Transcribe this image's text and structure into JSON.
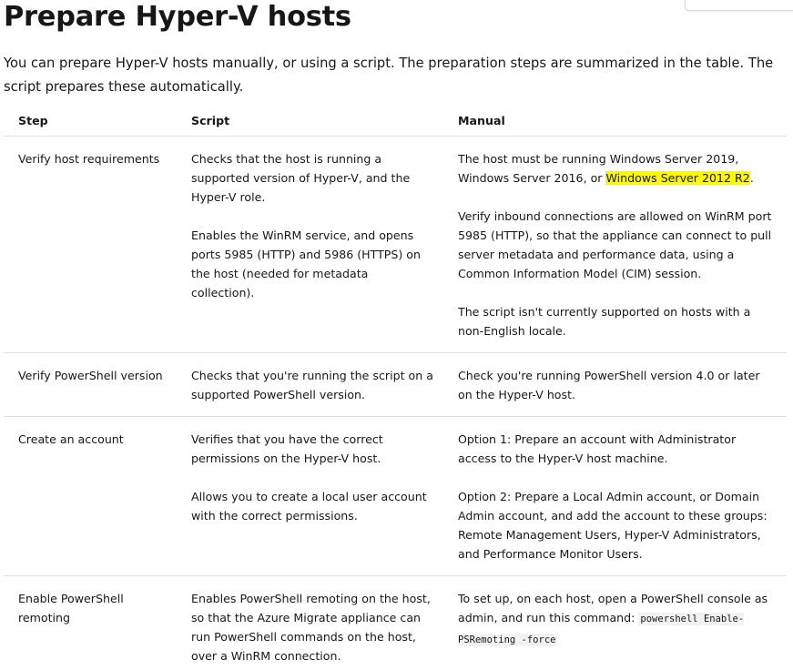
{
  "page": {
    "title": "Prepare Hyper-V hosts",
    "intro": "You can prepare Hyper-V hosts manually, or using a script. The preparation steps are summarized in the table. The script prepares these automatically."
  },
  "table": {
    "headers": {
      "step": "Step",
      "script": "Script",
      "manual": "Manual"
    },
    "rows": [
      {
        "step": "Verify host requirements",
        "script": [
          "Checks that the host is running a supported version of Hyper-V, and the Hyper-V role.",
          "Enables the WinRM service, and opens ports 5985 (HTTP) and 5986 (HTTPS) on the host (needed for metadata collection)."
        ],
        "manual_first_prefix": "The host must be running Windows Server 2019, Windows Server 2016, or ",
        "manual_first_highlight": "Windows Server 2012 R2",
        "manual_first_suffix": ".",
        "manual": [
          "Verify inbound connections are allowed on WinRM port 5985 (HTTP), so that the appliance can connect to pull server metadata and performance data, using a Common Information Model (CIM) session.",
          "The script isn't currently supported on hosts with a non-English locale."
        ]
      },
      {
        "step": "Verify PowerShell version",
        "script": [
          "Checks that you're running the script on a supported PowerShell version."
        ],
        "manual": [
          "Check you're running PowerShell version 4.0 or later on the Hyper-V host."
        ]
      },
      {
        "step": "Create an account",
        "script": [
          "Verifies that you have the correct permissions on the Hyper-V host.",
          "Allows you to create a local user account with the correct permissions."
        ],
        "manual": [
          "Option 1: Prepare an account with Administrator access to the Hyper-V host machine.",
          "Option 2: Prepare a Local Admin account, or Domain Admin account, and add the account to these groups: Remote Management Users, Hyper-V Administrators, and Performance Monitor Users."
        ]
      },
      {
        "step": "Enable PowerShell remoting",
        "script": [
          "Enables PowerShell remoting on the host, so that the Azure Migrate appliance can run PowerShell commands on the host, over a WinRM connection."
        ],
        "manual_text": "To set up, on each host, open a PowerShell console as admin, and run this command: ",
        "manual_code": "powershell Enable-PSRemoting -force"
      }
    ]
  },
  "colors": {
    "text": "#171717",
    "highlight": "#fbf70a",
    "code_background": "#f2f2f2",
    "divider": "#e1e1e1"
  }
}
